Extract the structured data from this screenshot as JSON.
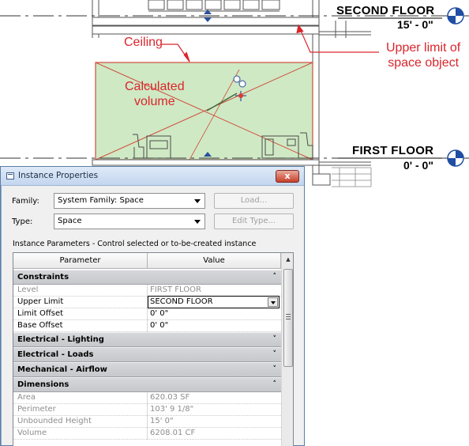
{
  "levels": {
    "second": {
      "name": "SECOND FLOOR",
      "elevation": "15' - 0\""
    },
    "first": {
      "name": "FIRST FLOOR",
      "elevation": "0' - 0\""
    }
  },
  "callouts": {
    "ceiling": "Ceiling",
    "upper_limit": [
      "Upper limit of",
      "space object"
    ],
    "calc_volume": [
      "Calculated",
      "volume"
    ]
  },
  "colors": {
    "space_fill": "#cfe9c4",
    "space_border": "#d04a3c",
    "callout_red": "#d9262c",
    "level_blue": "#1f4ea3"
  },
  "dialog": {
    "title": "Instance Properties",
    "close_label": "x",
    "family_label": "Family:",
    "family_value": "System Family: Space",
    "type_label": "Type:",
    "type_value": "Space",
    "load_label": "Load...",
    "edit_type_label": "Edit Type...",
    "instance_params_label": "Instance Parameters - Control selected or to-be-created instance",
    "columns": [
      "Parameter",
      "Value"
    ],
    "groups": [
      {
        "name": "Constraints",
        "expanded": true,
        "rows": [
          {
            "param": "Level",
            "value": "FIRST FLOOR",
            "readonly": true
          },
          {
            "param": "Upper Limit",
            "value": "SECOND FLOOR",
            "readonly": false,
            "dropdown": true
          },
          {
            "param": "Limit Offset",
            "value": "0'  0\"",
            "readonly": false
          },
          {
            "param": "Base Offset",
            "value": "0'  0\"",
            "readonly": false
          }
        ]
      },
      {
        "name": "Electrical - Lighting",
        "expanded": false,
        "rows": []
      },
      {
        "name": "Electrical - Loads",
        "expanded": false,
        "rows": []
      },
      {
        "name": "Mechanical - Airflow",
        "expanded": false,
        "rows": []
      },
      {
        "name": "Dimensions",
        "expanded": true,
        "rows": [
          {
            "param": "Area",
            "value": "620.03 SF",
            "readonly": true
          },
          {
            "param": "Perimeter",
            "value": "103'  9 1/8\"",
            "readonly": true
          },
          {
            "param": "Unbounded Height",
            "value": "15'  0\"",
            "readonly": true
          },
          {
            "param": "Volume",
            "value": "6208.01 CF",
            "readonly": true
          }
        ]
      }
    ]
  }
}
